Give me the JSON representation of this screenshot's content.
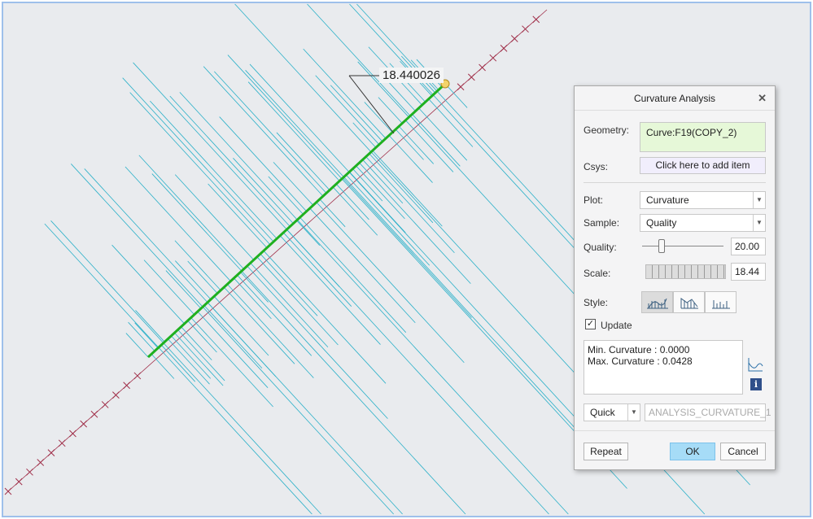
{
  "viewport": {
    "dimension_value": "18.440026"
  },
  "dialog": {
    "title": "Curvature Analysis",
    "geometry_label": "Geometry:",
    "geometry_value": "Curve:F19(COPY_2)",
    "csys_label": "Csys:",
    "csys_placeholder": "Click here to add item",
    "plot_label": "Plot:",
    "plot_value": "Curvature",
    "sample_label": "Sample:",
    "sample_value": "Quality",
    "quality_label": "Quality:",
    "quality_value": "20.00",
    "quality_slider_fraction": 0.25,
    "scale_label": "Scale:",
    "scale_value": "18.44",
    "style_label": "Style:",
    "update_label": "Update",
    "update_checked": true,
    "min_curvature": "Min. Curvature : 0.0000",
    "max_curvature": "Max. Curvature : 0.0428",
    "save_mode": "Quick",
    "analysis_name": "ANALYSIS_CURVATURE_1",
    "repeat_label": "Repeat",
    "ok_label": "OK",
    "cancel_label": "Cancel"
  },
  "colors": {
    "curve": "#1fb01f",
    "comb": "#2ab0c8",
    "axis": "#a0304a",
    "ok": "#a6dcf7",
    "geometry_bg": "#e6f8d8",
    "csys_bg": "#f1eefc"
  }
}
